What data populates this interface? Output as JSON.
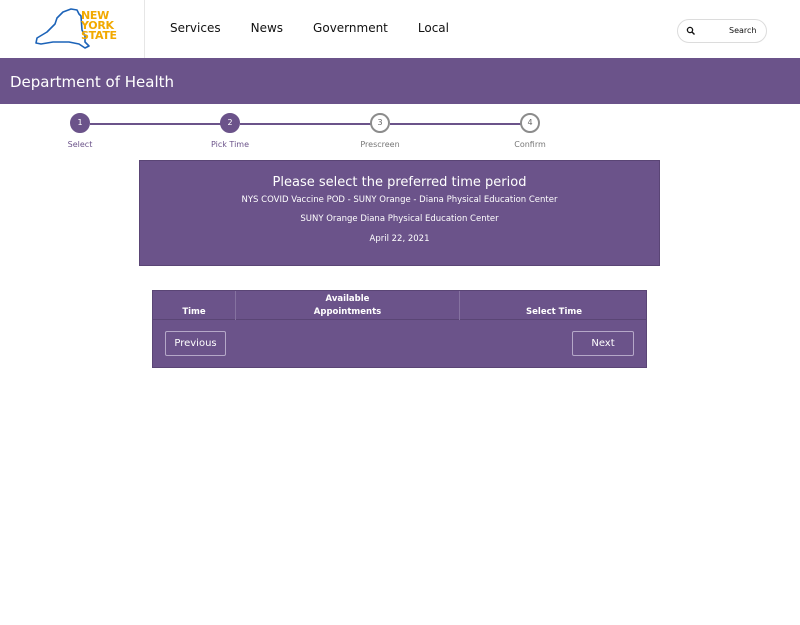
{
  "header": {
    "logo_lines": [
      "NEW",
      "YORK",
      "STATE"
    ],
    "nav": [
      "Services",
      "News",
      "Government",
      "Local"
    ],
    "search_label": "Search"
  },
  "banner": {
    "title": "Department of Health"
  },
  "stepper": {
    "steps": [
      {
        "number": "1",
        "label": "Select",
        "state": "complete"
      },
      {
        "number": "2",
        "label": "Pick Time",
        "state": "current"
      },
      {
        "number": "3",
        "label": "Prescreen",
        "state": "future"
      },
      {
        "number": "4",
        "label": "Confirm",
        "state": "future"
      }
    ]
  },
  "info": {
    "title": "Please select the preferred time period",
    "site_name": "NYS COVID Vaccine POD - SUNY Orange - Diana Physical Education Center",
    "location": "SUNY Orange Diana Physical Education Center",
    "date": "April 22, 2021"
  },
  "table": {
    "headers": {
      "time": "Time",
      "available_line1": "Available",
      "available_line2": "Appointments",
      "select": "Select Time"
    },
    "previous_label": "Previous",
    "next_label": "Next"
  },
  "colors": {
    "brand_purple": "#6b538a",
    "logo_gold": "#f2a900",
    "logo_blue": "#1c63b8"
  }
}
